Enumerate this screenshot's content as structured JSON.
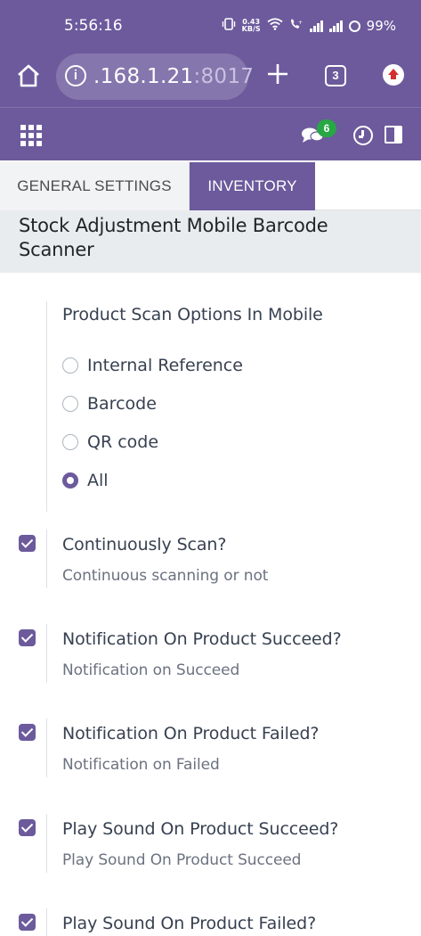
{
  "status_bar": {
    "time": "5:56:16",
    "net_speed_value": "0.43",
    "net_speed_unit": "KB/S",
    "battery": "99%"
  },
  "browser": {
    "url_host": ".168.1.21",
    "url_port": ":8017",
    "tab_count": "3"
  },
  "app_bar": {
    "chat_badge": "6"
  },
  "tabs": [
    {
      "label": "GENERAL SETTINGS",
      "active": false
    },
    {
      "label": "INVENTORY",
      "active": true
    }
  ],
  "section": {
    "title": "Stock Adjustment Mobile Barcode Scanner"
  },
  "scan_options": {
    "title": "Product Scan Options In Mobile",
    "options": [
      {
        "label": "Internal Reference",
        "selected": false
      },
      {
        "label": "Barcode",
        "selected": false
      },
      {
        "label": "QR code",
        "selected": false
      },
      {
        "label": "All",
        "selected": true
      }
    ]
  },
  "settings": [
    {
      "title": "Continuously Scan?",
      "desc": "Continuous scanning or not",
      "checked": true
    },
    {
      "title": "Notification On Product Succeed?",
      "desc": "Notification on Succeed",
      "checked": true
    },
    {
      "title": "Notification On Product Failed?",
      "desc": "Notification on Failed",
      "checked": true
    },
    {
      "title": "Play Sound On Product Succeed?",
      "desc": "Play Sound On Product Succeed",
      "checked": true
    },
    {
      "title": "Play Sound On Product Failed?",
      "desc": "",
      "checked": true
    }
  ],
  "colors": {
    "brand": "#6c5a9c",
    "badge": "#28a745",
    "section_bg": "#e9ecef"
  }
}
